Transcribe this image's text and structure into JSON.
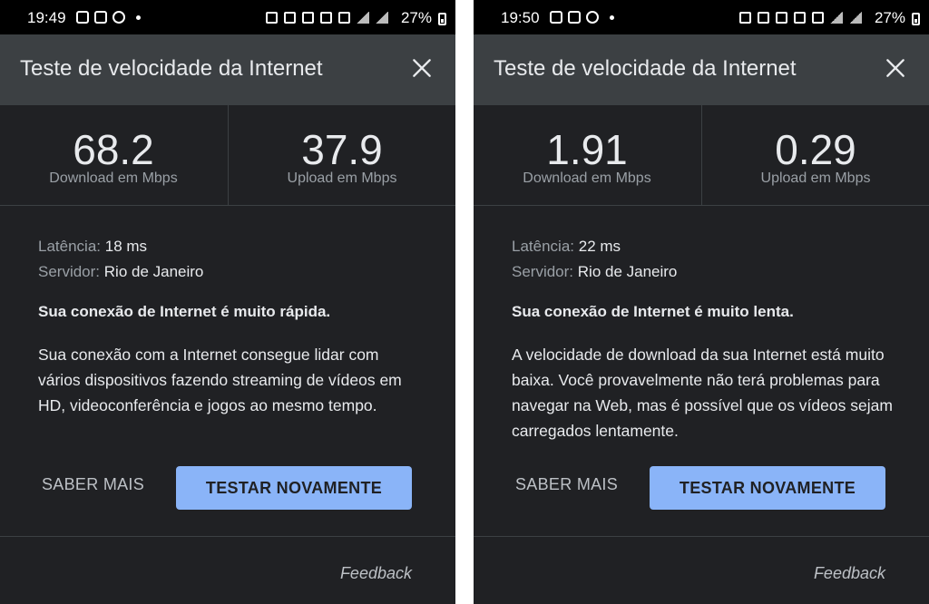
{
  "left": {
    "status_bar": {
      "time": "19:49",
      "battery": "27%"
    },
    "header": {
      "title": "Teste de velocidade da Internet"
    },
    "download": {
      "value": "68.2",
      "label": "Download em Mbps"
    },
    "upload": {
      "value": "37.9",
      "label": "Upload em Mbps"
    },
    "latency": {
      "label": "Latência:",
      "value": "18 ms"
    },
    "server": {
      "label": "Servidor:",
      "value": "Rio de Janeiro"
    },
    "verdict": "Sua conexão de Internet é muito rápida.",
    "explanation": "Sua conexão com a Internet consegue lidar com vários dispositivos fazendo streaming de vídeos em HD, videoconferência e jogos ao mesmo tempo.",
    "learn_more": "SABER MAIS",
    "retest": "TESTAR NOVAMENTE",
    "feedback": "Feedback"
  },
  "right": {
    "status_bar": {
      "time": "19:50",
      "battery": "27%"
    },
    "header": {
      "title": "Teste de velocidade da Internet"
    },
    "download": {
      "value": "1.91",
      "label": "Download em Mbps"
    },
    "upload": {
      "value": "0.29",
      "label": "Upload em Mbps"
    },
    "latency": {
      "label": "Latência:",
      "value": "22 ms"
    },
    "server": {
      "label": "Servidor:",
      "value": "Rio de Janeiro"
    },
    "verdict": "Sua conexão de Internet é muito lenta.",
    "explanation": "A velocidade de download da sua Internet está muito baixa. Você provavelmente não terá problemas para navegar na Web, mas é possível que os vídeos sejam carregados lentamente.",
    "learn_more": "SABER MAIS",
    "retest": "TESTAR NOVAMENTE",
    "feedback": "Feedback"
  },
  "colors": {
    "background": "#202124",
    "header": "#3c4043",
    "accent_button": "#8ab4f8",
    "text_primary": "#e8eaed",
    "text_secondary": "#9aa0a6"
  },
  "icons": [
    "instagram-icon",
    "notification-icon",
    "soccer-ball-icon",
    "image-icon",
    "alarm-icon",
    "bluetooth-icon",
    "mute-icon",
    "wifi-icon",
    "volte-icon",
    "signal-icon",
    "battery-icon",
    "close-icon"
  ]
}
